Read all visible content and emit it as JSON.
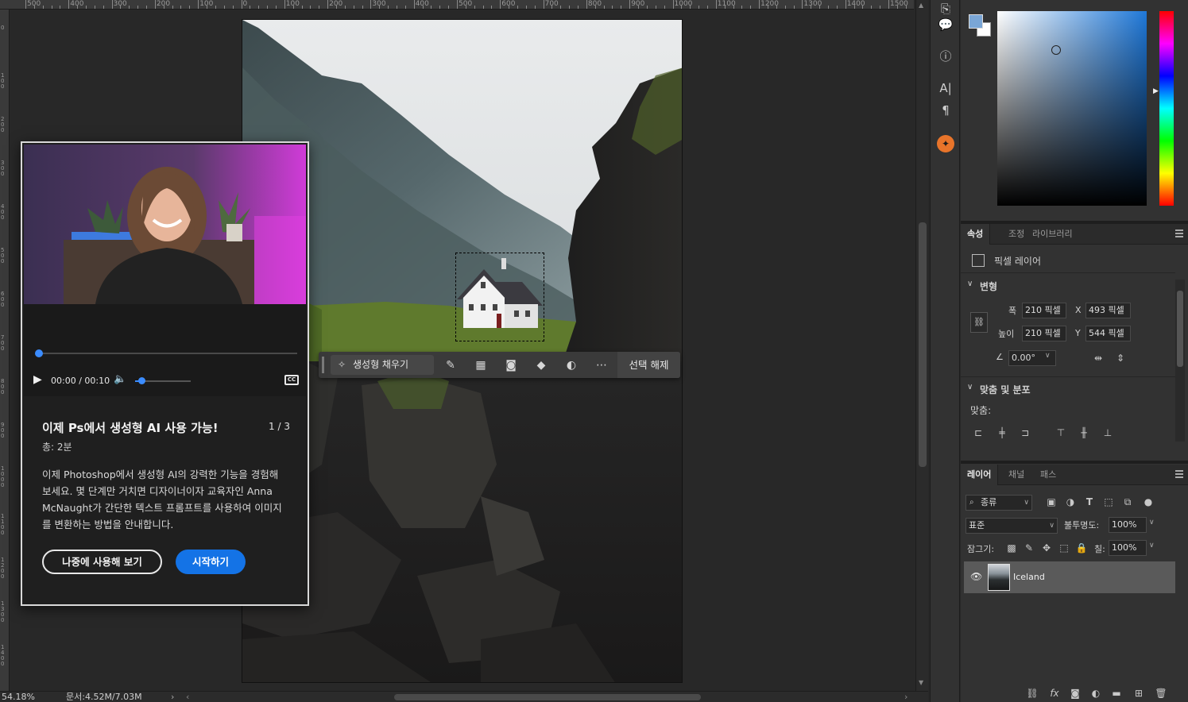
{
  "ruler": {
    "top_labels": [
      "500",
      "400",
      "300",
      "200",
      "100",
      "0",
      "100",
      "200",
      "300",
      "400",
      "500",
      "600",
      "700",
      "800",
      "900",
      "1000",
      "1100",
      "1200",
      "1300",
      "1400",
      "1500"
    ]
  },
  "status": {
    "zoom": "54.18%",
    "doc_size": "문서:4.52M/7.03M"
  },
  "popup": {
    "time": "00:00 / 00:10",
    "cc_label": "CC",
    "title": "이제 Ps에서 생성형 AI 사용 가능!",
    "pager": "1 / 3",
    "duration": "총: 2분",
    "body": "이제 Photoshop에서 생성형 AI의 강력한 기능을 경험해 보세요. 몇 단계만 거치면 디자이너이자 교육자인 Anna McNaught가 간단한 텍스트 프롬프트를 사용하여 이미지를 변환하는 방법을 안내합니다.",
    "later_label": "나중에 사용해 보기",
    "start_label": "시작하기",
    "progress": 0,
    "volume": 0.1
  },
  "taskbar": {
    "gen_fill_label": "생성형 채우기",
    "deselect_label": "선택 해제"
  },
  "properties": {
    "tabs": [
      "속성",
      "조정",
      "라이브러리"
    ],
    "layer_type": "픽셀 레이어",
    "transform_heading": "변형",
    "width_label": "폭",
    "width_value": "210 픽셀",
    "height_label": "높이",
    "height_value": "210 픽셀",
    "x_label": "X",
    "x_value": "493 픽셀",
    "y_label": "Y",
    "y_value": "544 픽셀",
    "angle_value": "0.00°",
    "align_heading": "맞춤 및 분포",
    "align_label": "맞춤:"
  },
  "layers": {
    "tabs": [
      "레이어",
      "채널",
      "패스"
    ],
    "filter_label": "종류",
    "blend_mode": "표준",
    "opacity_label": "불투명도:",
    "opacity_value": "100%",
    "lock_label": "잠그기:",
    "fill_label": "칠:",
    "fill_value": "100%",
    "items": [
      {
        "name": "Iceland",
        "visible": true
      }
    ]
  },
  "colors": {
    "accent": "#1473e6",
    "foreground_swatch": "#7aa6d6",
    "picker_hue": "#1f78d8"
  }
}
